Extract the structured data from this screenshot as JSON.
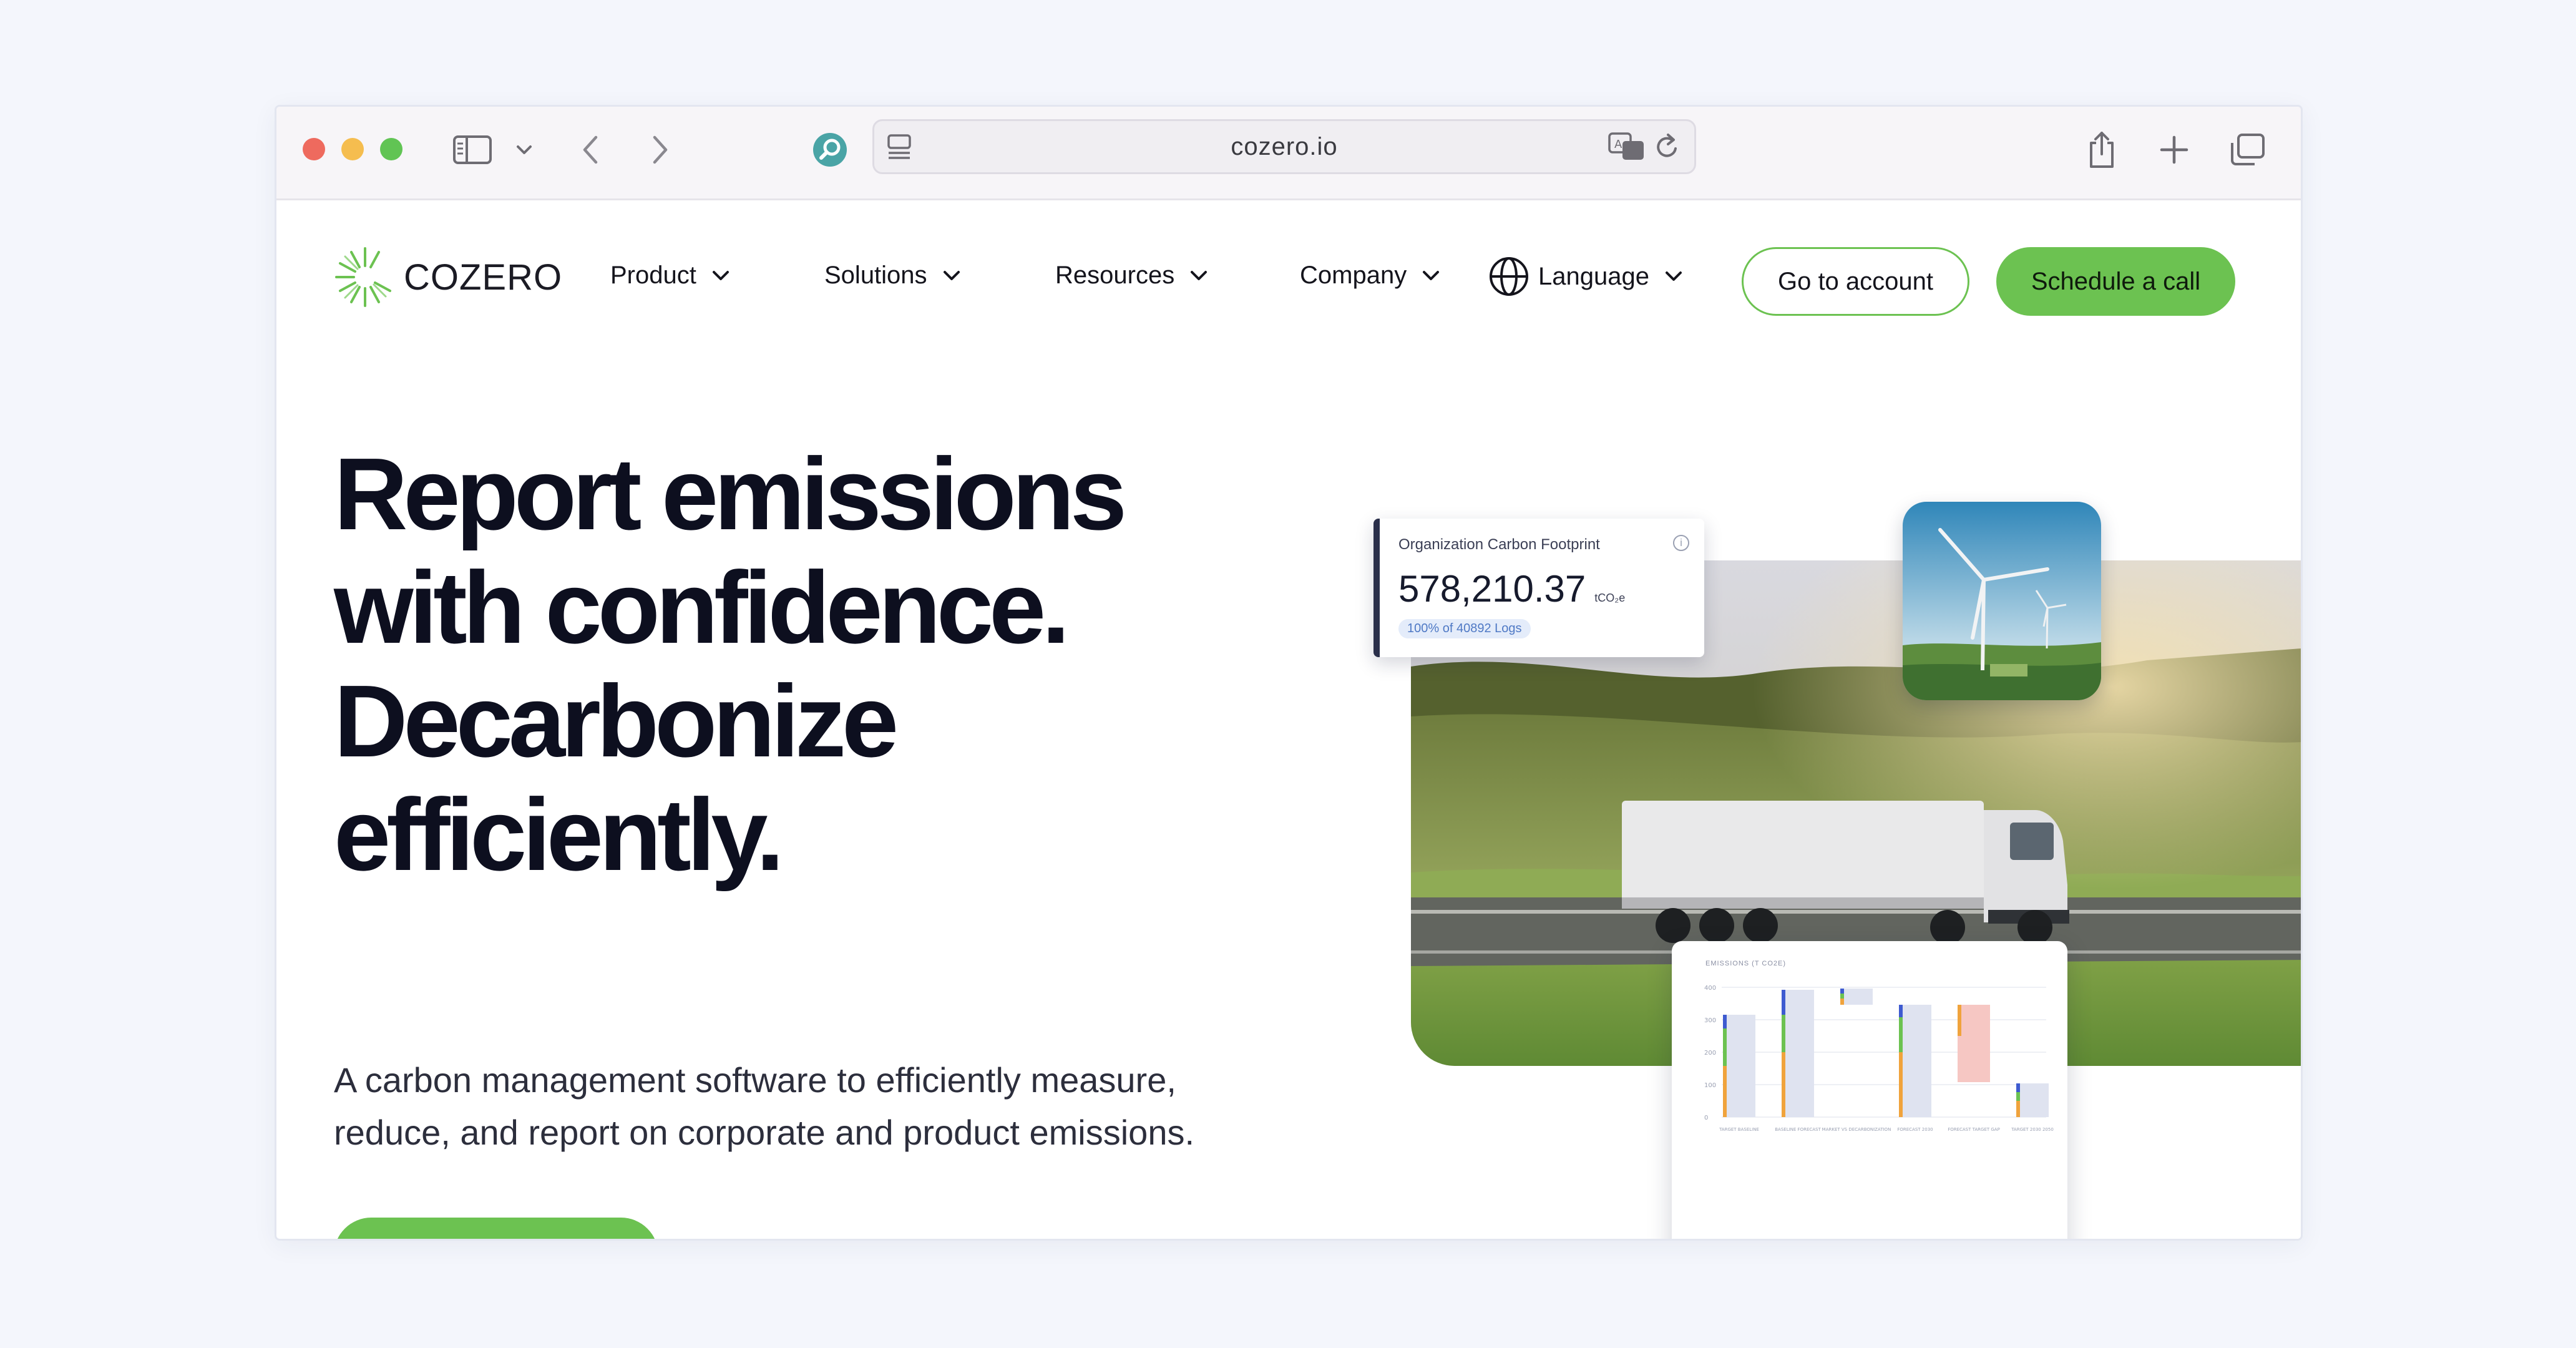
{
  "browser": {
    "url": "cozero.io",
    "icons": [
      "sidebar-icon",
      "chevron-down-icon",
      "back-icon",
      "forward-icon",
      "search-extension-icon",
      "page-menu-icon",
      "translate-icon",
      "reload-icon",
      "share-icon",
      "new-tab-icon",
      "tabs-overview-icon"
    ]
  },
  "nav": {
    "logo_text": "COZERO",
    "items": [
      "Product",
      "Solutions",
      "Resources",
      "Company"
    ],
    "language_label": "Language",
    "account_label": "Go to account",
    "call_label": "Schedule a call"
  },
  "hero": {
    "title_lines": [
      "Report emissions",
      "with confidence.",
      "Decarbonize",
      "efficiently."
    ],
    "subtitle_lines": [
      "A carbon management software to efficiently measure,",
      "reduce, and report on corporate and product emissions."
    ]
  },
  "footprint_card": {
    "label": "Organization Carbon Footprint",
    "value": "578,210.37",
    "unit": "tCO₂e",
    "pill": "100% of 40892 Logs"
  },
  "emissions_chart": {
    "title": "EMISSIONS (T CO2E)",
    "y_ticks": [
      "400",
      "300",
      "200",
      "100",
      "0"
    ],
    "categories": [
      "TARGET BASELINE",
      "BASELINE FORECAST",
      "MARKET VS DECARBONIZATION",
      "FORECAST 2030",
      "FORECAST TARGET GAP",
      "TARGET 2030 2050"
    ]
  },
  "colors": {
    "brand_green": "#6cc251",
    "text_dark": "#0d0f1f"
  }
}
